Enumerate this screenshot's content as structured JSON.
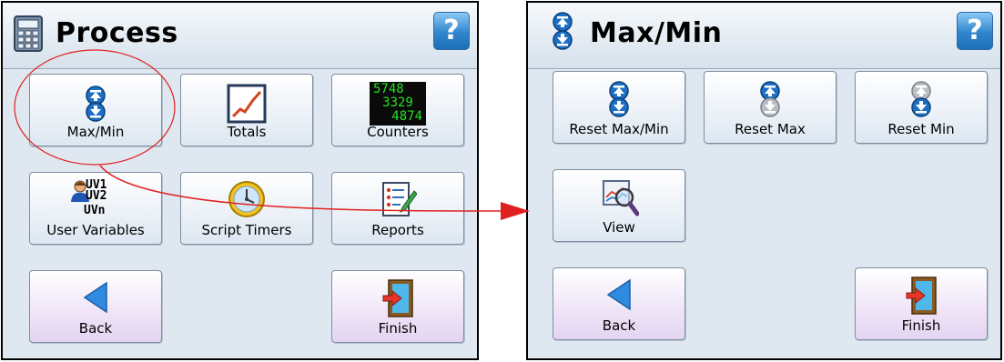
{
  "left_panel": {
    "title": "Process",
    "help": "?",
    "buttons": {
      "maxmin": "Max/Min",
      "totals": "Totals",
      "counters": "Counters",
      "user_variables": "User Variables",
      "script_timers": "Script Timers",
      "reports": "Reports",
      "back": "Back",
      "finish": "Finish"
    },
    "counter_values": [
      "5748",
      "3329",
      "4874"
    ],
    "user_var_labels": [
      "UV1",
      "UV2",
      "UVn"
    ]
  },
  "right_panel": {
    "title": "Max/Min",
    "help": "?",
    "buttons": {
      "reset_maxmin": "Reset Max/Min",
      "reset_max": "Reset Max",
      "reset_min": "Reset Min",
      "view": "View",
      "back": "Back",
      "finish": "Finish"
    }
  },
  "colors": {
    "panel_bg": "#dfe8f1",
    "help_blue": "#2f86cf",
    "annotation_red": "#e02020",
    "counter_green": "#22e022"
  },
  "icons": [
    "calculator-icon",
    "maxmin-icon",
    "chart-icon",
    "counter-display-icon",
    "user-variables-icon",
    "clock-icon",
    "reports-icon",
    "back-arrow-icon",
    "exit-door-icon",
    "magnifier-chart-icon",
    "help-icon"
  ]
}
